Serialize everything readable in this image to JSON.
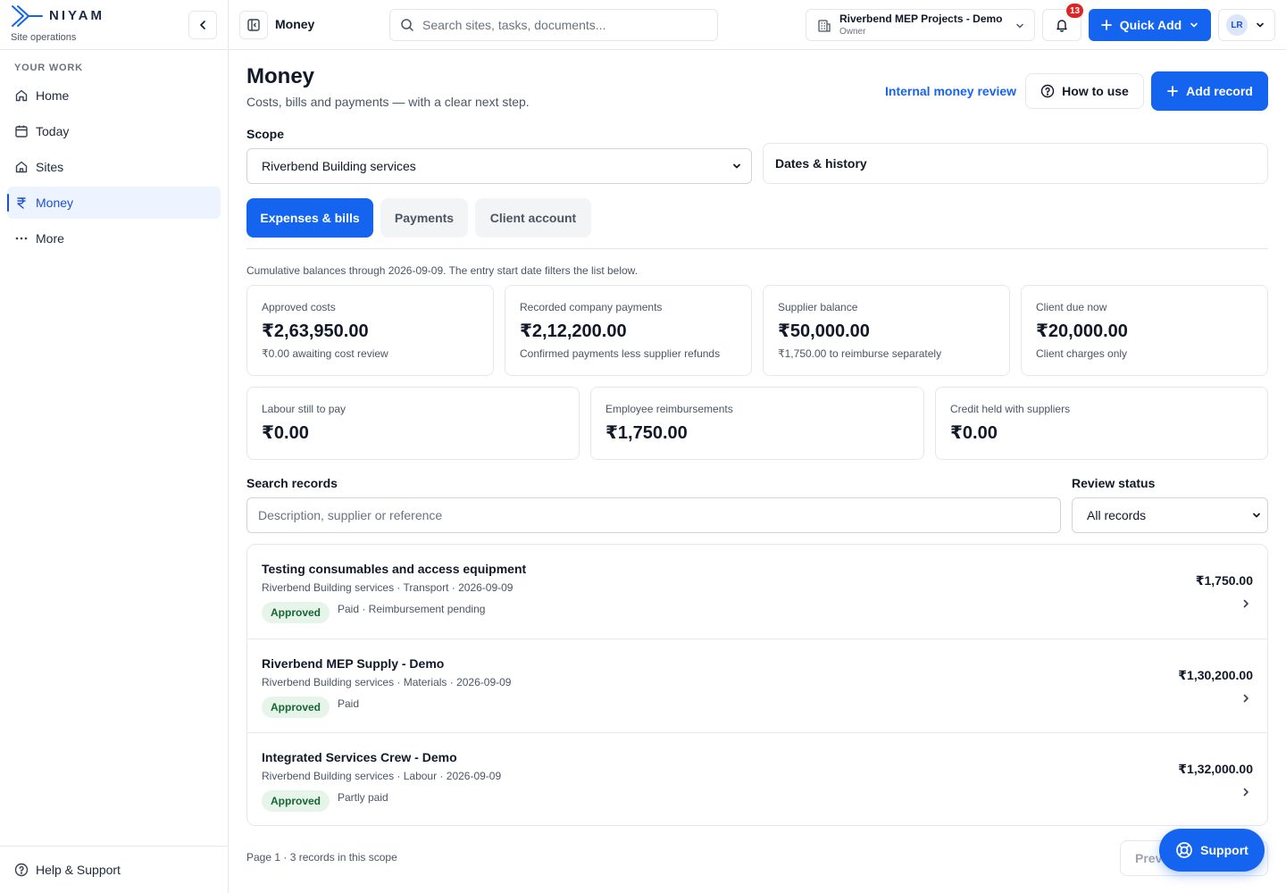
{
  "brand": {
    "name": "NIYAM",
    "subtitle": "Site operations"
  },
  "sidebar": {
    "section_label": "YOUR WORK",
    "items": [
      {
        "label": "Home",
        "icon": "home-icon"
      },
      {
        "label": "Today",
        "icon": "calendar-icon"
      },
      {
        "label": "Sites",
        "icon": "building-icon"
      },
      {
        "label": "Money",
        "icon": "rupee-icon",
        "active": true
      },
      {
        "label": "More",
        "icon": "more-icon"
      }
    ],
    "help_label": "Help & Support"
  },
  "topbar": {
    "title": "Money",
    "search_placeholder": "Search sites, tasks, documents...",
    "org_name": "Riverbend MEP Projects - Demo",
    "org_role": "Owner",
    "notification_count": "13",
    "quick_add_label": "Quick Add",
    "avatar_initials": "LR"
  },
  "page": {
    "title": "Money",
    "subtitle": "Costs, bills and payments — with a clear next step.",
    "review_link": "Internal money review",
    "how_to_use": "How to use",
    "add_record": "Add record",
    "scope_label": "Scope",
    "scope_value": "Riverbend Building services",
    "dates_history": "Dates & history",
    "tabs": [
      "Expenses & bills",
      "Payments",
      "Client account"
    ],
    "cumulative_note": "Cumulative balances through 2026-09-09. The entry start date filters the list below."
  },
  "summary_cards": [
    {
      "label": "Approved costs",
      "value": "₹2,63,950.00",
      "note": "₹0.00 awaiting cost review"
    },
    {
      "label": "Recorded company payments",
      "value": "₹2,12,200.00",
      "note": "Confirmed payments less supplier refunds"
    },
    {
      "label": "Supplier balance",
      "value": "₹50,000.00",
      "note": "₹1,750.00 to reimburse separately"
    },
    {
      "label": "Client due now",
      "value": "₹20,000.00",
      "note": "Client charges only"
    },
    {
      "label": "Labour still to pay",
      "value": "₹0.00"
    },
    {
      "label": "Employee reimbursements",
      "value": "₹1,750.00"
    },
    {
      "label": "Credit held with suppliers",
      "value": "₹0.00"
    }
  ],
  "filters": {
    "search_label": "Search records",
    "search_placeholder": "Description, supplier or reference",
    "status_label": "Review status",
    "status_value": "All records"
  },
  "records": [
    {
      "title": "Testing consumables and access equipment",
      "meta": "Riverbend Building services · Transport · 2026-09-09",
      "badge": "Approved",
      "status": "Paid · Reimbursement pending",
      "amount": "₹1,750.00"
    },
    {
      "title": "Riverbend MEP Supply - Demo",
      "meta": "Riverbend Building services · Materials · 2026-09-09",
      "badge": "Approved",
      "status": "Paid",
      "amount": "₹1,30,200.00"
    },
    {
      "title": "Integrated Services Crew - Demo",
      "meta": "Riverbend Building services · Labour · 2026-09-09",
      "badge": "Approved",
      "status": "Partly paid",
      "amount": "₹1,32,000.00"
    }
  ],
  "footer": {
    "page_info": "Page 1 · 3 records in this scope",
    "prev_label": "Prev",
    "support_label": "Support"
  },
  "colors": {
    "accent": "#1564ef",
    "success_bg": "#e6f4ea",
    "success_text": "#166534",
    "badge": "#dc2626"
  }
}
